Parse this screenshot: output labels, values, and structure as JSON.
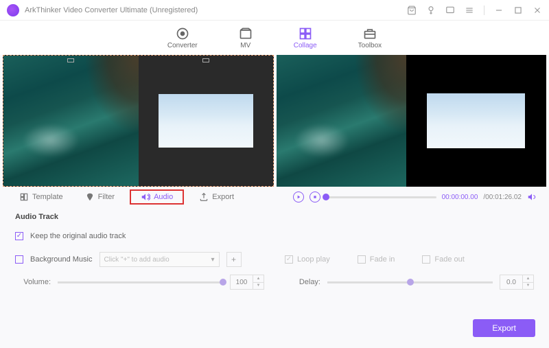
{
  "title": "ArkThinker Video Converter Ultimate (Unregistered)",
  "maintabs": {
    "converter": "Converter",
    "mv": "MV",
    "collage": "Collage",
    "toolbox": "Toolbox"
  },
  "subtabs": {
    "template": "Template",
    "filter": "Filter",
    "audio": "Audio",
    "export": "Export"
  },
  "preview": {
    "current": "00:00:00.00",
    "total": "/00:01:26.02"
  },
  "audio": {
    "heading": "Audio Track",
    "keep_original": "Keep the original audio track",
    "bg_music_label": "Background Music",
    "bg_music_placeholder": "Click \"+\" to add audio",
    "loop": "Loop play",
    "fadein": "Fade in",
    "fadeout": "Fade out",
    "volume_label": "Volume:",
    "volume_value": "100",
    "delay_label": "Delay:",
    "delay_value": "0.0"
  },
  "footer": {
    "export": "Export"
  }
}
